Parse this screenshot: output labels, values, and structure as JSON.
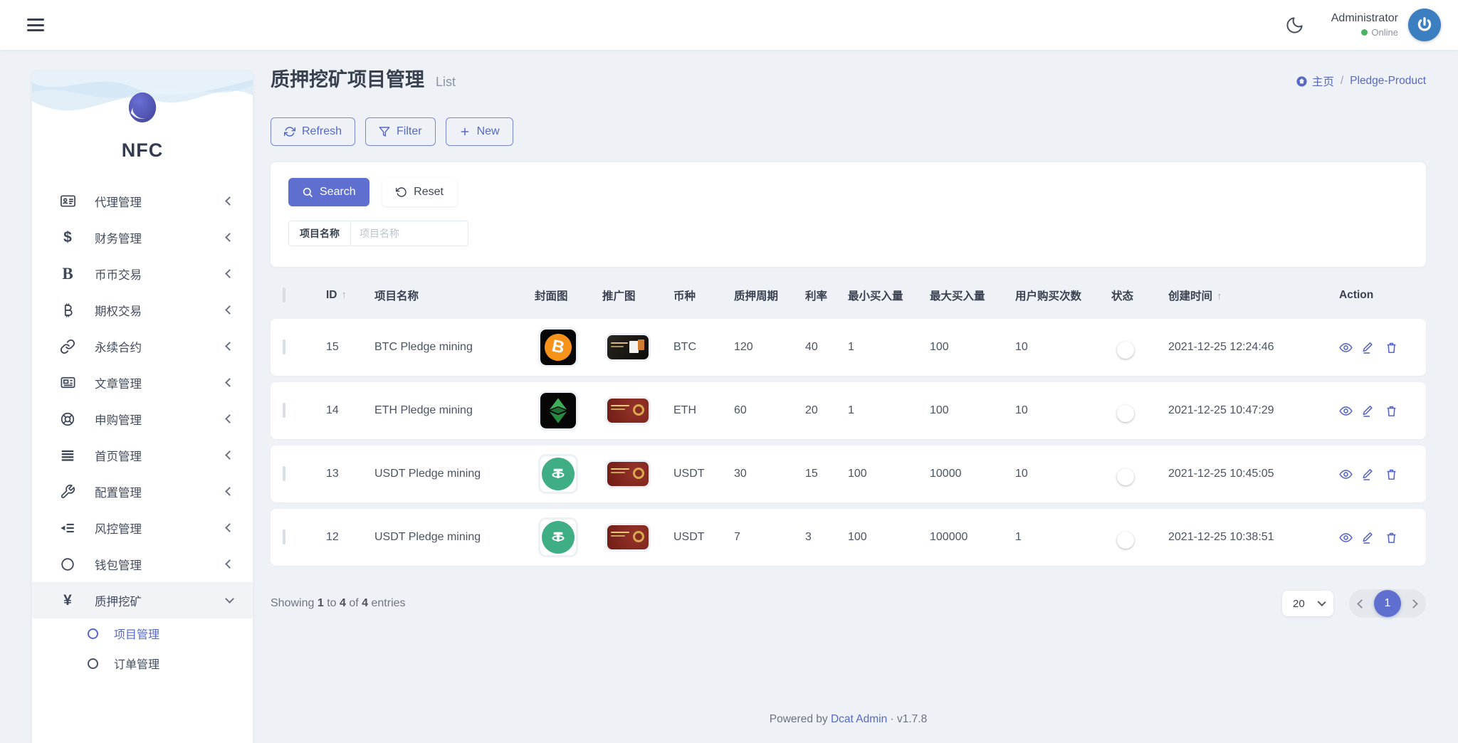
{
  "header": {
    "user_name": "Administrator",
    "user_status": "Online"
  },
  "breadcrumb": {
    "home": "主页",
    "separator": "/",
    "current": "Pledge-Product"
  },
  "page": {
    "title": "质押挖矿项目管理",
    "subtitle": "List"
  },
  "toolbar": {
    "refresh": "Refresh",
    "filter": "Filter",
    "new": "New"
  },
  "search": {
    "search_label": "Search",
    "reset_label": "Reset",
    "field_label": "项目名称",
    "field_placeholder": "项目名称"
  },
  "sidebar": {
    "logo_text": "NFC",
    "items": [
      {
        "label": "代理管理",
        "icon": "id-card"
      },
      {
        "label": "财务管理",
        "icon": "dollar"
      },
      {
        "label": "币币交易",
        "icon": "currency-b"
      },
      {
        "label": "期权交易",
        "icon": "bitcoin"
      },
      {
        "label": "永续合约",
        "icon": "chain-link"
      },
      {
        "label": "文章管理",
        "icon": "newspaper"
      },
      {
        "label": "申购管理",
        "icon": "life-ring"
      },
      {
        "label": "首页管理",
        "icon": "align-justify"
      },
      {
        "label": "配置管理",
        "icon": "wrench"
      },
      {
        "label": "风控管理",
        "icon": "outdent-list"
      },
      {
        "label": "钱包管理",
        "icon": "circle"
      },
      {
        "label": "质押挖矿",
        "icon": "yen",
        "expanded": true
      }
    ],
    "submenu": [
      {
        "label": "项目管理",
        "active": true
      },
      {
        "label": "订单管理",
        "active": false
      }
    ]
  },
  "table": {
    "columns": [
      "",
      "ID",
      "项目名称",
      "封面图",
      "推广图",
      "币种",
      "质押周期",
      "利率",
      "最小买入量",
      "最大买入量",
      "用户购买次数",
      "状态",
      "创建时间",
      "Action"
    ],
    "sort_arrow": "↑",
    "rows": [
      {
        "id": "15",
        "name": "BTC Pledge mining",
        "cover": "btc",
        "promo": "black-card",
        "coin": "BTC",
        "period": "120",
        "rate": "40",
        "min": "1",
        "max": "100",
        "count": "10",
        "status_on": true,
        "created": "2021-12-25 12:24:46"
      },
      {
        "id": "14",
        "name": "ETH Pledge mining",
        "cover": "eth",
        "promo": "red-card",
        "coin": "ETH",
        "period": "60",
        "rate": "20",
        "min": "1",
        "max": "100",
        "count": "10",
        "status_on": true,
        "created": "2021-12-25 10:47:29"
      },
      {
        "id": "13",
        "name": "USDT Pledge mining",
        "cover": "usdt",
        "promo": "red-card",
        "coin": "USDT",
        "period": "30",
        "rate": "15",
        "min": "100",
        "max": "10000",
        "count": "10",
        "status_on": true,
        "created": "2021-12-25 10:45:05"
      },
      {
        "id": "12",
        "name": "USDT Pledge mining",
        "cover": "usdt",
        "promo": "red-card",
        "coin": "USDT",
        "period": "7",
        "rate": "3",
        "min": "100",
        "max": "100000",
        "count": "1",
        "status_on": true,
        "created": "2021-12-25 10:38:51"
      }
    ],
    "btc_symbol": "B"
  },
  "pagination": {
    "words": {
      "showing": "Showing",
      "to": "to",
      "of": "of",
      "entries": "entries"
    },
    "from": "1",
    "to": "4",
    "total": "4",
    "page_size": "20",
    "current_page": "1"
  },
  "footer": {
    "powered_by": "Powered by",
    "brand": "Dcat Admin",
    "dot": "·",
    "version": "v1.7.8"
  },
  "icons": {
    "hamburger": "menu",
    "moon": "dark-mode",
    "power": "avatar-power",
    "home": "breadcrumb-home",
    "refresh": "circular-arrows",
    "filter": "funnel",
    "plus": "+",
    "search": "magnifier",
    "reset": "undo-arrow",
    "view": "eye",
    "edit": "pencil",
    "delete": "trash",
    "sort": "↑"
  },
  "colors": {
    "accent": "#5868c5",
    "accent_fill": "#5f6fd0",
    "toggle_on": "#6373d6",
    "avatar_blue": "#3c7fc0",
    "online_green": "#48b461",
    "page_bg": "#eef2f7",
    "btc_orange": "#f7931a",
    "usdt_green": "#3fae85"
  }
}
